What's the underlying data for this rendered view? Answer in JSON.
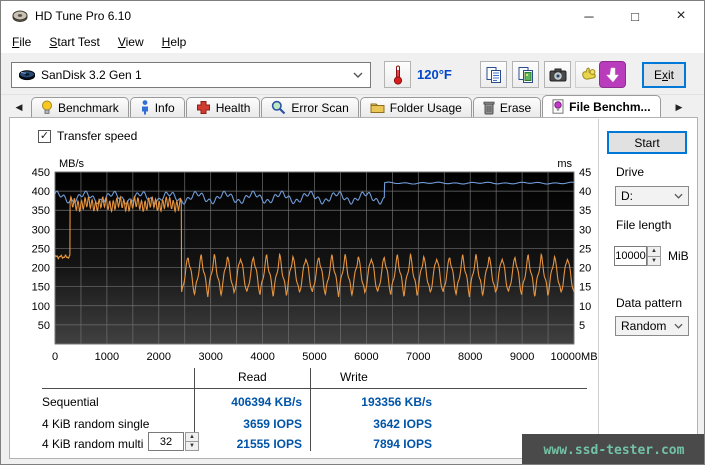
{
  "window": {
    "title": "HD Tune Pro 6.10"
  },
  "icons": {
    "minimize": "─",
    "maximize": "□",
    "close": "×",
    "tab_prev": "◀",
    "tab_next": "▶",
    "spin_up": "▲",
    "spin_down": "▼",
    "check": "✓"
  },
  "menu": {
    "items": [
      {
        "key": "F",
        "rest": "ile"
      },
      {
        "key": "S",
        "rest": "tart Test"
      },
      {
        "key": "V",
        "rest": "iew"
      },
      {
        "key": "H",
        "rest": "elp"
      }
    ]
  },
  "toolbar": {
    "drive_select": "SanDisk 3.2 Gen 1",
    "temperature": "120°F",
    "exit": {
      "pre": "E",
      "key": "x",
      "rest": "it"
    }
  },
  "tabs": {
    "items": [
      {
        "label": "Benchmark"
      },
      {
        "label": "Info"
      },
      {
        "label": "Health"
      },
      {
        "label": "Error Scan"
      },
      {
        "label": "Folder Usage"
      },
      {
        "label": "Erase"
      },
      {
        "label": "File Benchm...",
        "active": true
      }
    ]
  },
  "fb": {
    "transfer_speed_label": "Transfer speed",
    "start_button": "Start",
    "drive_label": "Drive",
    "drive_value": "D:",
    "file_length_label": "File length",
    "file_length_value": "10000",
    "file_length_unit": "MiB",
    "data_pattern_label": "Data pattern",
    "data_pattern_value": "Random",
    "results": {
      "read_header": "Read",
      "write_header": "Write",
      "rows": [
        {
          "label": "Sequential",
          "read": "406394 KB/s",
          "write": "193356 KB/s"
        },
        {
          "label": "4 KiB random single",
          "read": "3659 IOPS",
          "write": "3642 IOPS"
        },
        {
          "label": "4 KiB random multi",
          "queue_depth": "32",
          "read": "21555 IOPS",
          "write": "7894 IOPS"
        }
      ]
    }
  },
  "watermark": {
    "text": "www.ssd-tester.com"
  },
  "colors": {
    "read_line": "#6f9bd8",
    "write_line": "#e8953f",
    "grid": "#6f6f6f",
    "value_text": "#0054a8",
    "focus_accent": "#0078d7",
    "temperature_text": "#0047c8",
    "watermark_bg": "#4a4a4a",
    "watermark_text": "#72c3a6"
  },
  "chart_data": {
    "type": "line",
    "title": "Transfer speed",
    "x_range": [
      0,
      10000
    ],
    "x_ticks": [
      "0",
      "1000",
      "2000",
      "3000",
      "4000",
      "5000",
      "6000",
      "7000",
      "8000",
      "9000",
      "10000MB"
    ],
    "y_left": {
      "unit": "MB/s",
      "range": [
        0,
        450
      ],
      "ticks": [
        "450",
        "400",
        "350",
        "300",
        "250",
        "200",
        "150",
        "100",
        "50"
      ]
    },
    "y_right": {
      "unit": "ms",
      "range": [
        0,
        45
      ],
      "ticks": [
        "45",
        "40",
        "35",
        "30",
        "25",
        "20",
        "15",
        "10",
        "5"
      ]
    },
    "grid": {
      "x_step": 500,
      "y_step": 50
    },
    "legend": "none",
    "series": [
      {
        "name": "read speed",
        "color_key": "read_line",
        "unit": "MB/s",
        "summary": "steady ~370-405 MB/s from 0 to ~6350MB, then steps up to ~421 MB/s until 10000MB",
        "segments": [
          {
            "x0": 0,
            "x1": 6350,
            "base": 383,
            "a1": 6,
            "p1": 140,
            "a2": 11,
            "p2": 540,
            "wave": "sin"
          },
          {
            "x0": 6350,
            "x1": 10000,
            "base": 421,
            "a1": 1.5,
            "p1": 320,
            "a2": 1,
            "p2": 900,
            "wave": "sin"
          }
        ]
      },
      {
        "name": "write speed",
        "color_key": "write_line",
        "unit": "MB/s",
        "summary": "~228 MB/s for 0-290MB, ~350-385 MB/s (cache) until ~2440MB, then oscillates ~130-235 MB/s until 10000MB",
        "segments": [
          {
            "x0": 0,
            "x1": 290,
            "base": 228,
            "a1": 3,
            "p1": 90,
            "a2": 2,
            "p2": 40,
            "wave": "sin"
          },
          {
            "x0": 290,
            "x1": 2440,
            "base": 366,
            "a1": 13,
            "p1": 68,
            "a2": 6,
            "p2": 310,
            "wave": "sin"
          },
          {
            "x0": 2440,
            "x1": 10000,
            "base": 180,
            "a1": 50,
            "p1": 252,
            "a2": 7,
            "p2": 90,
            "wave": "tri"
          }
        ]
      }
    ]
  }
}
